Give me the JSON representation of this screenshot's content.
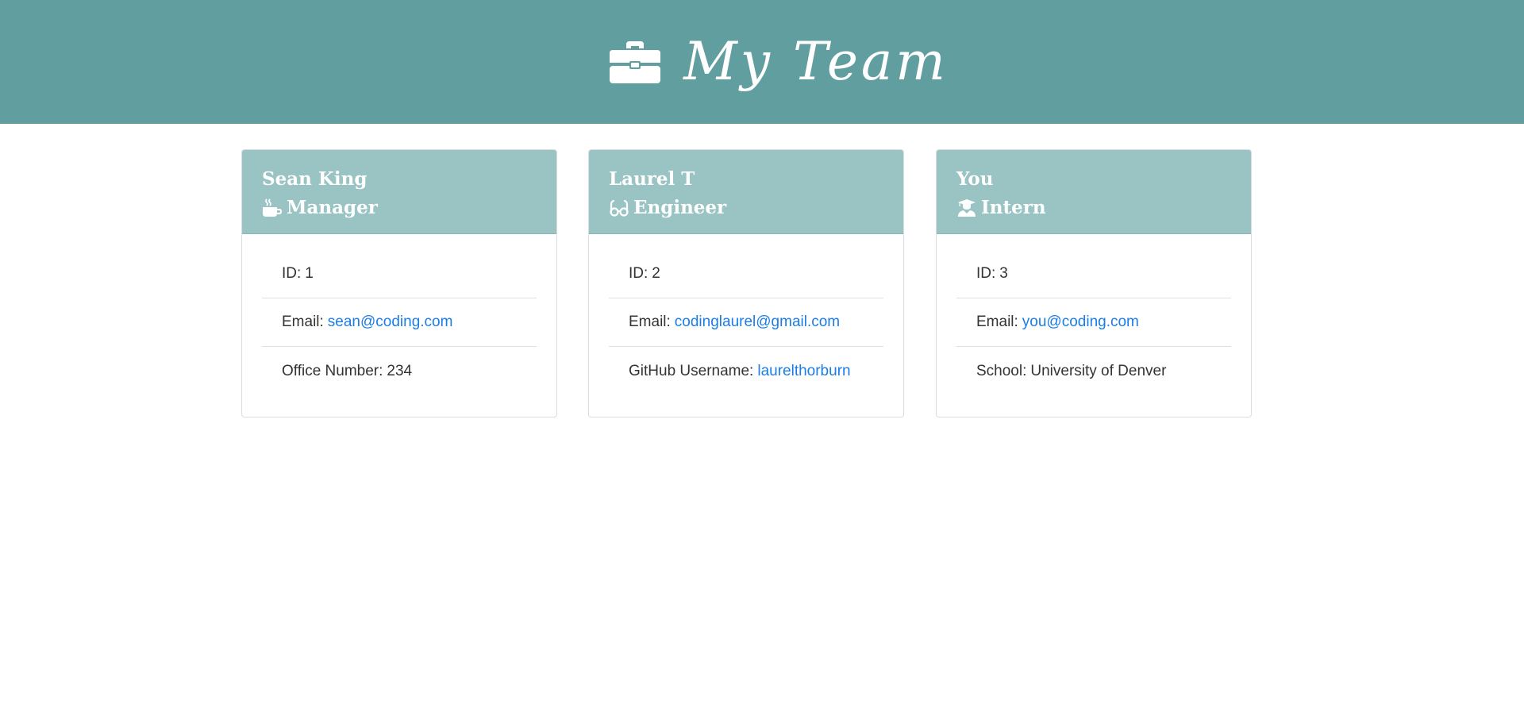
{
  "header": {
    "title": "My Team",
    "icon": "briefcase-icon",
    "background": "#619e9f"
  },
  "cards": [
    {
      "name": "Sean King",
      "role": "Manager",
      "role_icon": "coffee-mug-icon",
      "items": [
        {
          "label": "ID:",
          "value": "1"
        },
        {
          "label": "Email:",
          "value": "sean@coding.com"
        },
        {
          "label": "Office Number:",
          "value": "234"
        }
      ]
    },
    {
      "name": "Laurel T",
      "role": "Engineer",
      "role_icon": "glasses-icon",
      "items": [
        {
          "label": "ID:",
          "value": "2"
        },
        {
          "label": "Email:",
          "value": "codinglaurel@gmail.com"
        },
        {
          "label": "GitHub Username:",
          "value": "laurelthorburn"
        }
      ]
    },
    {
      "name": "You",
      "role": "Intern",
      "role_icon": "graduate-icon",
      "items": [
        {
          "label": "ID:",
          "value": "3"
        },
        {
          "label": "Email:",
          "value": "you@coding.com"
        },
        {
          "label": "School:",
          "value": "University of Denver"
        }
      ]
    }
  ],
  "colors": {
    "card_header": "#9ac3c4",
    "link": "#1a7de8",
    "text": "#333333"
  }
}
